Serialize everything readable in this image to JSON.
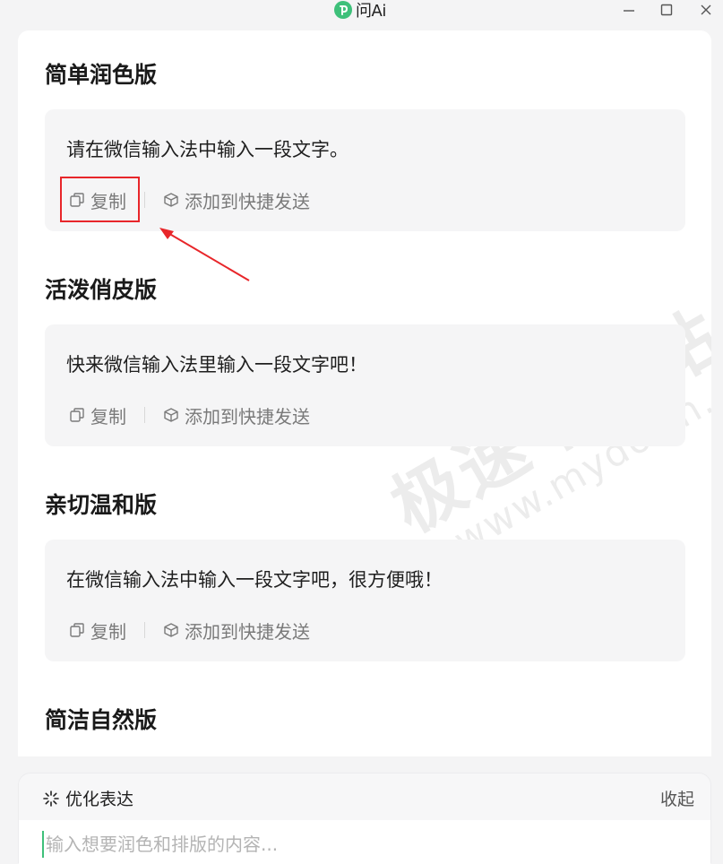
{
  "app": {
    "title": "问Ai"
  },
  "sections": [
    {
      "title": "简单润色版",
      "text": "请在微信输入法中输入一段文字。"
    },
    {
      "title": "活泼俏皮版",
      "text": "快来微信输入法里输入一段文字吧！"
    },
    {
      "title": "亲切温和版",
      "text": "在微信输入法中输入一段文字吧，很方便哦！"
    },
    {
      "title": "简洁自然版"
    }
  ],
  "actions": {
    "copy": "复制",
    "add_quick_send": "添加到快捷发送"
  },
  "watermark": {
    "cn": "极速下载站",
    "en": "www.mydown.com"
  },
  "bottom": {
    "mode": "优化表达",
    "collapse": "收起",
    "placeholder": "输入想要润色和排版的内容..."
  },
  "colors": {
    "brand": "#3ec07a",
    "annotation": "#e8262a",
    "card_bg": "#f5f5f6"
  }
}
